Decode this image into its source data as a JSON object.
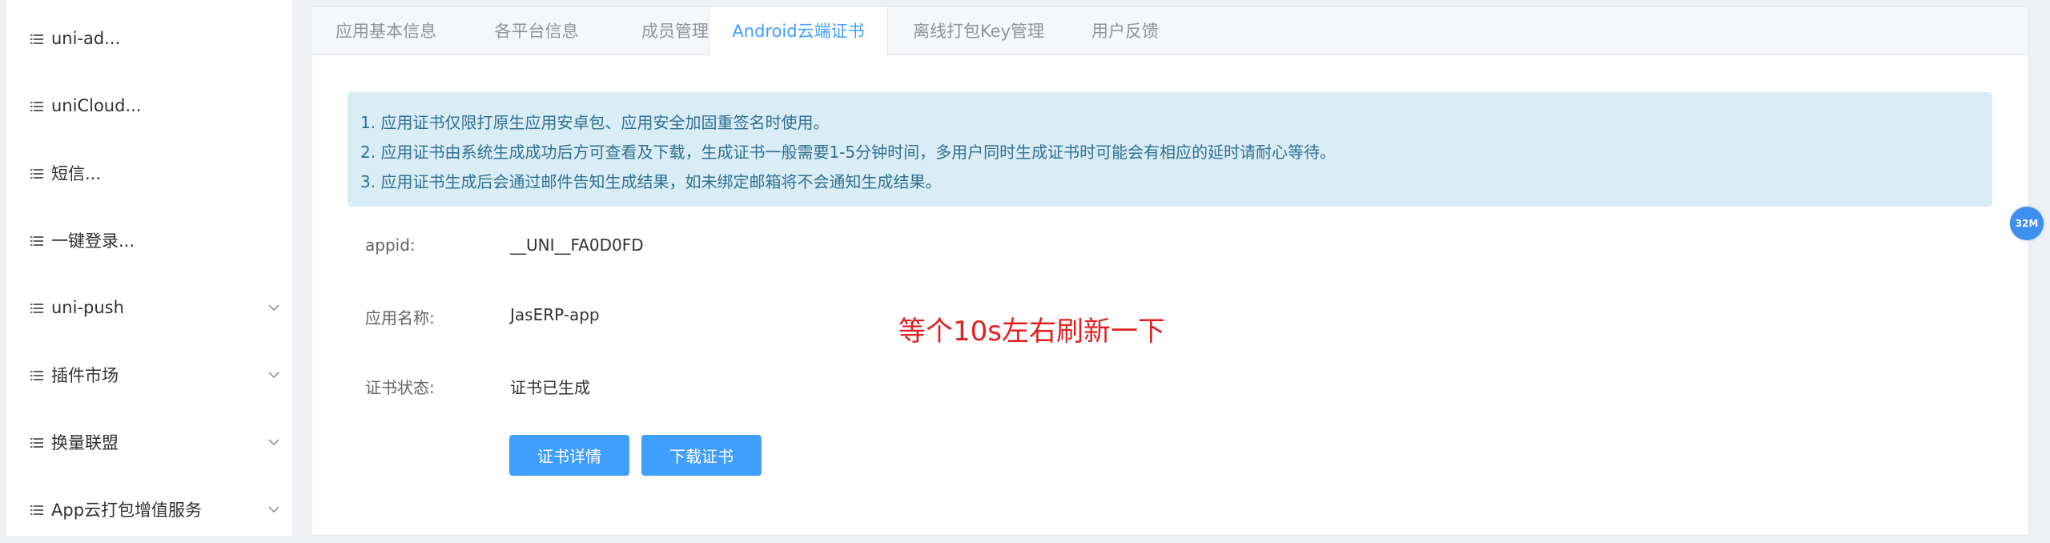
{
  "colors": {
    "accent": "#409eff",
    "notice_bg": "#d9edf7",
    "notice_text": "#31708f",
    "annotation": "#e02020",
    "badge": "#3f8ff0"
  },
  "sidebar": {
    "items": [
      {
        "label": "uni-ad...",
        "icon": "list-icon",
        "expandable": false
      },
      {
        "label": "uniCloud...",
        "icon": "list-icon",
        "expandable": false
      },
      {
        "label": "短信...",
        "icon": "list-icon",
        "expandable": false
      },
      {
        "label": "一键登录...",
        "icon": "list-icon",
        "expandable": false
      },
      {
        "label": "uni-push",
        "icon": "list-icon",
        "expandable": true
      },
      {
        "label": "插件市场",
        "icon": "list-icon",
        "expandable": true
      },
      {
        "label": "换量联盟",
        "icon": "list-icon",
        "expandable": true
      },
      {
        "label": "App云打包增值服务",
        "icon": "list-icon",
        "expandable": true
      }
    ]
  },
  "tabs": [
    {
      "label": "应用基本信息",
      "active": false
    },
    {
      "label": "各平台信息",
      "active": false
    },
    {
      "label": "成员管理",
      "active": false
    },
    {
      "label": "Android云端证书",
      "active": true
    },
    {
      "label": "离线打包Key管理",
      "active": false
    },
    {
      "label": "用户反馈",
      "active": false
    }
  ],
  "notice": {
    "lines": [
      "1. 应用证书仅限打原生应用安卓包、应用安全加固重签名时使用。",
      "2. 应用证书由系统生成成功后方可查看及下载，生成证书一般需要1-5分钟时间，多用户同时生成证书时可能会有相应的延时请耐心等待。",
      "3. 应用证书生成后会通过邮件告知生成结果，如未绑定邮箱将不会通知生成结果。"
    ]
  },
  "fields": {
    "appid": {
      "label": "appid:",
      "value": "__UNI__FA0D0FD"
    },
    "app_name": {
      "label": "应用名称:",
      "value": "JasERP-app"
    },
    "cert_status": {
      "label": "证书状态:",
      "value": "证书已生成"
    }
  },
  "buttons": {
    "details": "证书详情",
    "download": "下载证书"
  },
  "annotation": "等个10s左右刷新一下",
  "badge": "32M"
}
